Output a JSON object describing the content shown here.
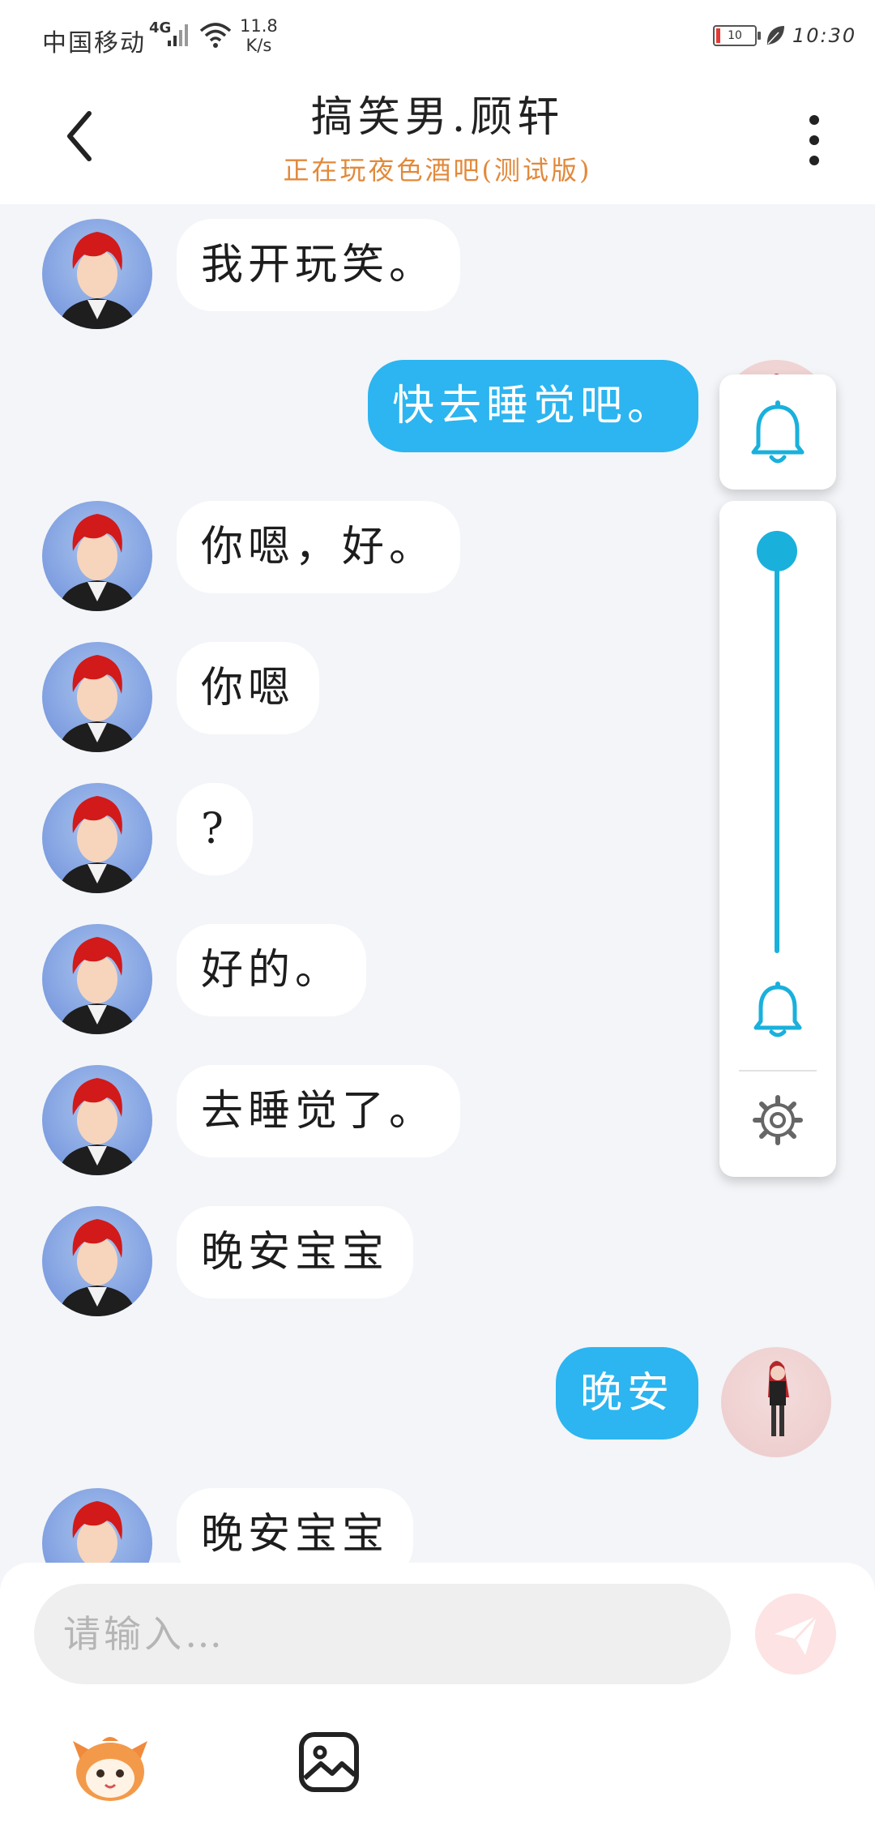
{
  "status_bar": {
    "carrier": "中国移动",
    "network_type": "4G",
    "speed_value": "11.8",
    "speed_unit": "K/s",
    "battery_level": "10",
    "time": "10:30"
  },
  "header": {
    "title": "搞笑男.顾轩",
    "subtitle": "正在玩夜色酒吧(测试版)",
    "back_icon": "chevron-left-icon",
    "more_icon": "more-vertical-icon"
  },
  "messages": [
    {
      "sender": "bot",
      "text": "我开玩笑。"
    },
    {
      "sender": "user",
      "text": "快去睡觉吧。"
    },
    {
      "sender": "bot",
      "text": "你嗯，好。"
    },
    {
      "sender": "bot",
      "text": "你嗯"
    },
    {
      "sender": "bot",
      "text": "?"
    },
    {
      "sender": "bot",
      "text": "好的。"
    },
    {
      "sender": "bot",
      "text": "去睡觉了。"
    },
    {
      "sender": "bot",
      "text": "晚安宝宝"
    },
    {
      "sender": "user",
      "text": "晚安"
    },
    {
      "sender": "bot",
      "text": "晚安宝宝"
    }
  ],
  "notification_panel": {
    "top_icon": "bell-icon",
    "slider_icon": "bell-icon",
    "settings_icon": "gear-icon",
    "slider_level": 1.0,
    "accent_color": "#1ab0dc"
  },
  "composer": {
    "placeholder": "请输入…",
    "value": "",
    "send_icon": "paper-plane-icon",
    "mascot_icon": "mascot-icon",
    "image_icon": "image-icon"
  },
  "colors": {
    "user_bubble": "#2cb5f0",
    "bot_bubble": "#ffffff",
    "subtitle": "#e2893a",
    "background": "#f3f5f8"
  }
}
